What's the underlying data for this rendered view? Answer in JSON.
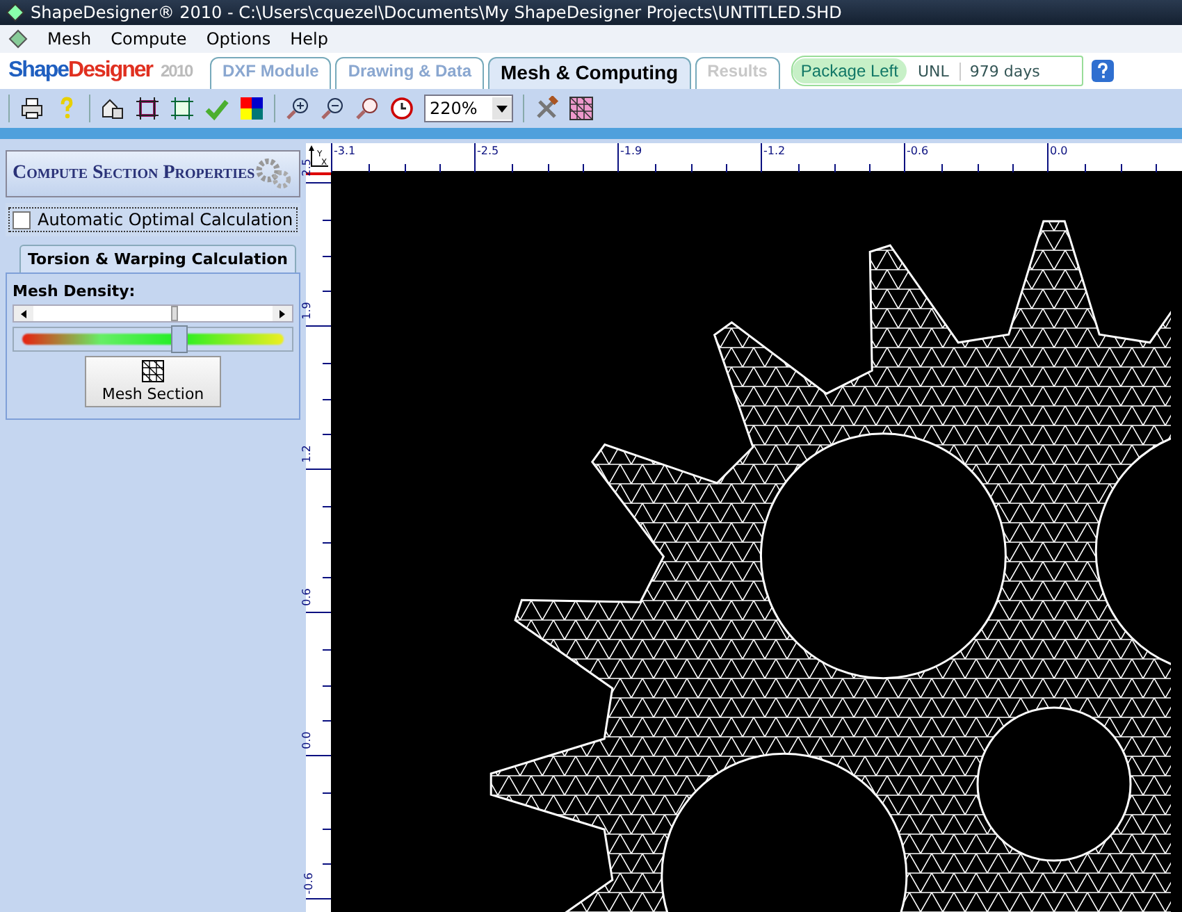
{
  "window": {
    "title": "ShapeDesigner® 2010 - C:\\Users\\cquezel\\Documents\\My ShapeDesigner Projects\\UNTITLED.SHD"
  },
  "menu": [
    "Mesh",
    "Compute",
    "Options",
    "Help"
  ],
  "logo": {
    "name_part_1": "Shape",
    "name_part_2": "Designer",
    "year": "2010"
  },
  "tabs": [
    {
      "label": "DXF Module",
      "selected": false,
      "disabled": false
    },
    {
      "label": "Drawing & Data",
      "selected": false,
      "disabled": false
    },
    {
      "label": "Mesh & Computing",
      "selected": true,
      "disabled": false
    },
    {
      "label": "Results",
      "selected": false,
      "disabled": true
    }
  ],
  "package": {
    "label": "Package Left",
    "type": "UNL",
    "remaining": "979 days"
  },
  "toolbar": {
    "zoom": "220%"
  },
  "panel": {
    "compute_button": "Compute Section Properties",
    "auto_checkbox": {
      "label": "Automatic Optimal Calculation",
      "checked": false
    },
    "sub_tabs": [
      {
        "label": "Torsion & Warping Calculation",
        "selected": true
      }
    ],
    "mesh_density": {
      "label": "Mesh Density:",
      "level": 0.59
    },
    "mesh_button": "Mesh Section"
  },
  "axes": {
    "y": "Y",
    "x": "X"
  },
  "rulers": {
    "horizontal": [
      "-3.1",
      "-2.5",
      "-1.9",
      "-1.2",
      "-0.6",
      "0.0"
    ],
    "vertical": [
      "2.5",
      "1.9",
      "1.2",
      "0.6",
      "0.0",
      "-0.6"
    ]
  }
}
